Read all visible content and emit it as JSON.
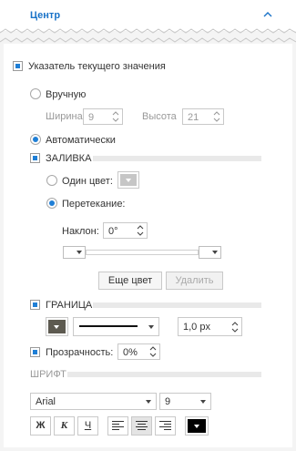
{
  "header": {
    "title": "Центр"
  },
  "indicator": {
    "label": "Указатель текущего значения",
    "checked": true
  },
  "size_mode": {
    "manual_label": "Вручную",
    "width_label": "Ширина",
    "width_value": "9",
    "height_label": "Высота",
    "height_value": "21",
    "auto_label": "Автоматически"
  },
  "fill": {
    "section_label": "ЗАЛИВКА",
    "single_color_label": "Один цвет:",
    "gradient_label": "Перетекание:",
    "angle_label": "Наклон:",
    "angle_value": "0°",
    "more_color_button": "Еще цвет",
    "delete_button": "Удалить"
  },
  "border": {
    "section_label": "ГРАНИЦА",
    "width_value": "1,0 px"
  },
  "transparency": {
    "label": "Прозрачность:",
    "value": "0%"
  },
  "font": {
    "section_label": "ШРИФТ",
    "family": "Arial",
    "size": "9",
    "bold_label": "Ж",
    "italic_label": "К",
    "underline_label": "Ч"
  }
}
